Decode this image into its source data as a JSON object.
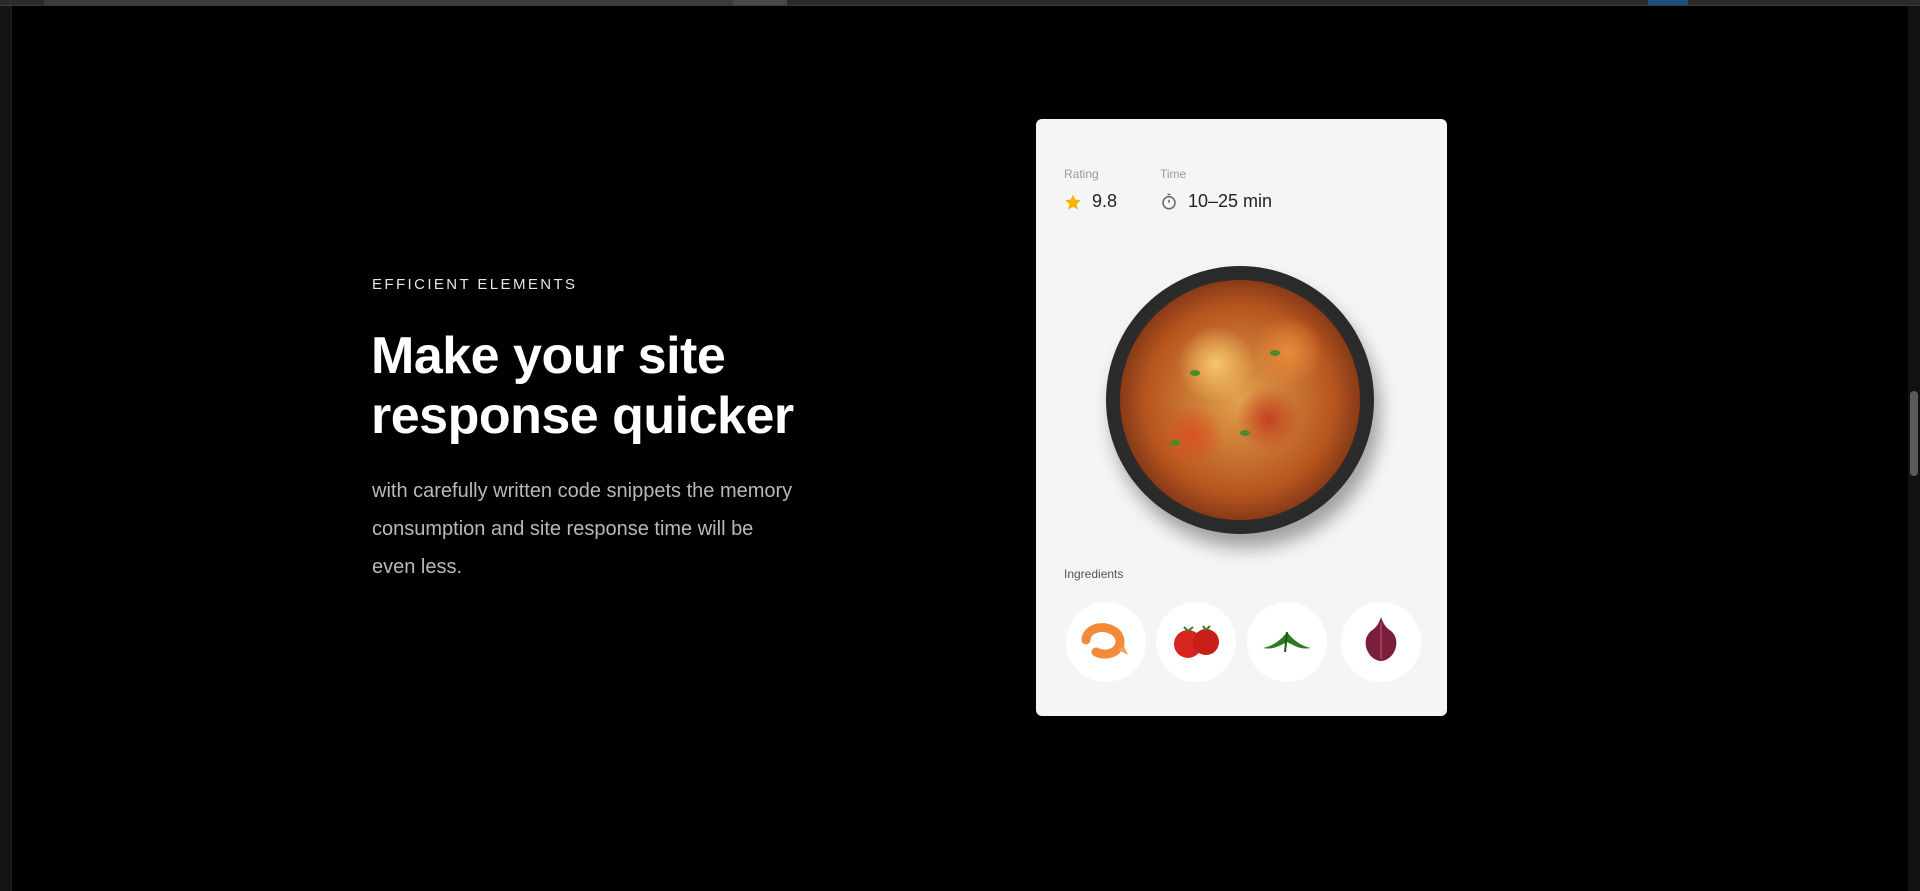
{
  "section": {
    "eyebrow": "EFFICIENT ELEMENTS",
    "headline": "Make your site response quicker",
    "description": "with carefully written code snippets the memory consumption and site response time will be even less."
  },
  "recipe_card": {
    "rating_label": "Rating",
    "rating_value": "9.8",
    "time_label": "Time",
    "time_value": "10–25 min",
    "ingredients_label": "Ingredients",
    "ingredients": [
      {
        "icon": "shrimp-icon"
      },
      {
        "icon": "tomato-icon"
      },
      {
        "icon": "parsley-icon"
      },
      {
        "icon": "onion-icon"
      }
    ],
    "colors": {
      "star": "#f5b400",
      "card_bg": "#f5f5f5"
    }
  }
}
